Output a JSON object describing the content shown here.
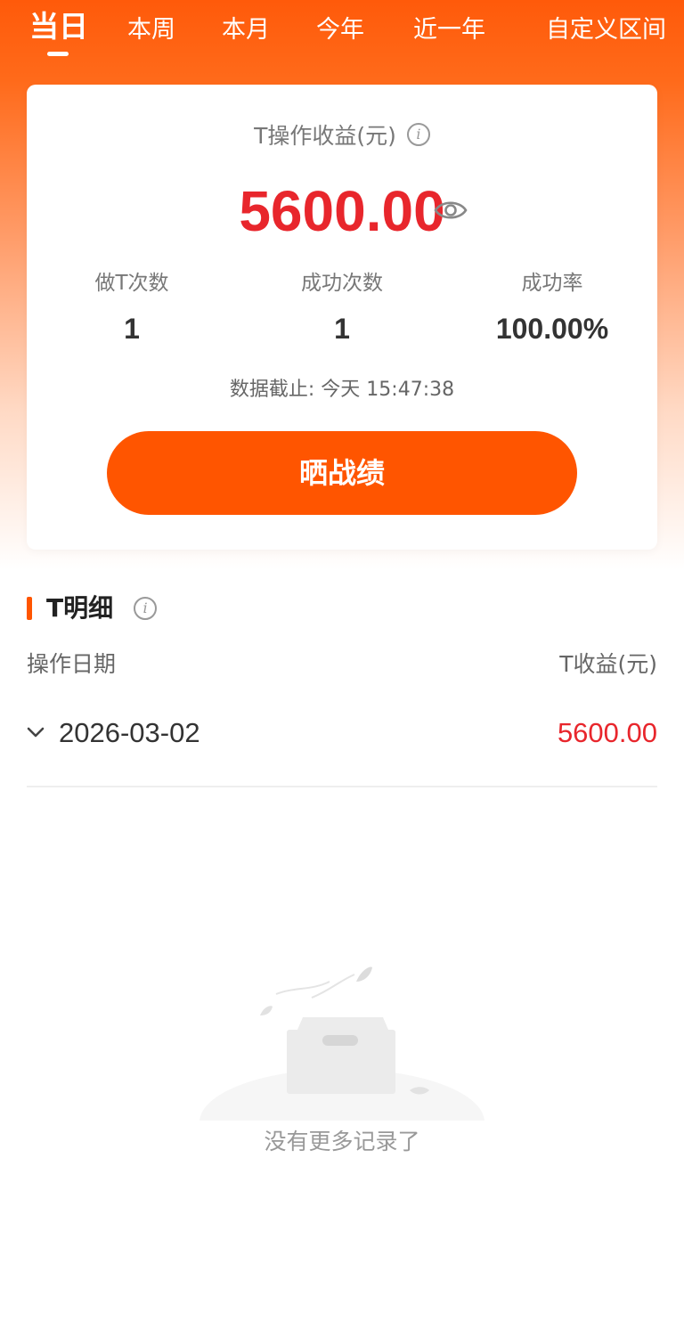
{
  "tabs": [
    {
      "label": "当日",
      "active": true
    },
    {
      "label": "本周",
      "active": false
    },
    {
      "label": "本月",
      "active": false
    },
    {
      "label": "今年",
      "active": false
    },
    {
      "label": "近一年",
      "active": false
    },
    {
      "label": "自定义区间",
      "active": false
    }
  ],
  "summary": {
    "title": "T操作收益(元)",
    "info_icon": "info-icon",
    "profit": "5600.00",
    "visibility_icon": "eye-icon",
    "stats": [
      {
        "label": "做T次数",
        "value": "1"
      },
      {
        "label": "成功次数",
        "value": "1"
      },
      {
        "label": "成功率",
        "value": "100.00%"
      }
    ],
    "updated": "数据截止: 今天 15:47:38",
    "share_label": "晒战绩"
  },
  "detail": {
    "title": "T明细",
    "col_date": "操作日期",
    "col_profit": "T收益(元)",
    "rows": [
      {
        "date": "2026-03-02",
        "profit": "5600.00"
      }
    ],
    "empty_text": "没有更多记录了"
  },
  "colors": {
    "brand": "#ff5500",
    "profit_red": "#e8262c"
  }
}
